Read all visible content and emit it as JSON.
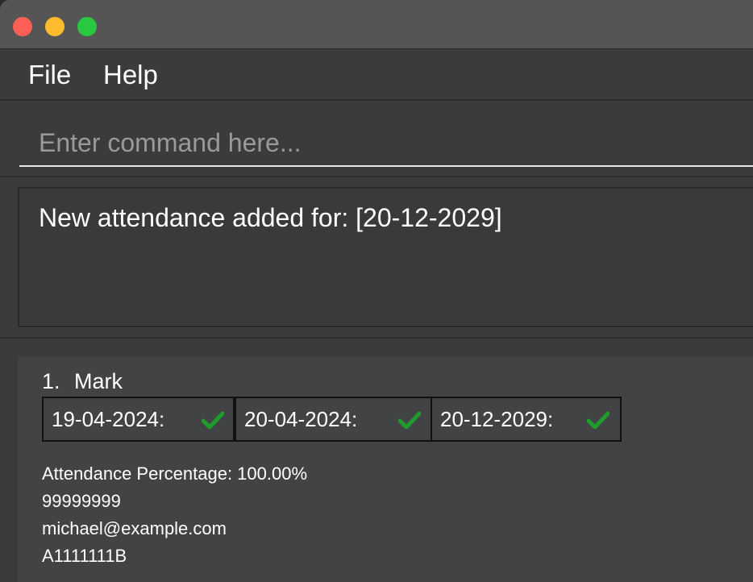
{
  "window": {
    "controls": {
      "close_icon": "close-icon",
      "minimize_icon": "minimize-icon",
      "maximize_icon": "maximize-icon"
    }
  },
  "menu": {
    "file_label": "File",
    "help_label": "Help"
  },
  "command": {
    "value": "",
    "placeholder": "Enter command here..."
  },
  "result": {
    "message": "New attendance added for: [20-12-2029]"
  },
  "persons": [
    {
      "index": "1.",
      "name": "Mark",
      "attendance": [
        {
          "date": "19-04-2024:",
          "status_icon": "check-icon",
          "present": true
        },
        {
          "date": "20-04-2024:",
          "status_icon": "check-icon",
          "present": true
        },
        {
          "date": "20-12-2029:",
          "status_icon": "check-icon",
          "present": true
        }
      ],
      "attendance_percentage": "Attendance Percentage: 100.00%",
      "phone": "99999999",
      "email": "michael@example.com",
      "student_id": "A1111111B"
    }
  ],
  "colors": {
    "background": "#3b3b3b",
    "titlebar": "#555556",
    "card": "#424345",
    "check": "#1f9c2b",
    "close": "#fe5f57",
    "minimize": "#febc2e",
    "maximize": "#28c840"
  }
}
